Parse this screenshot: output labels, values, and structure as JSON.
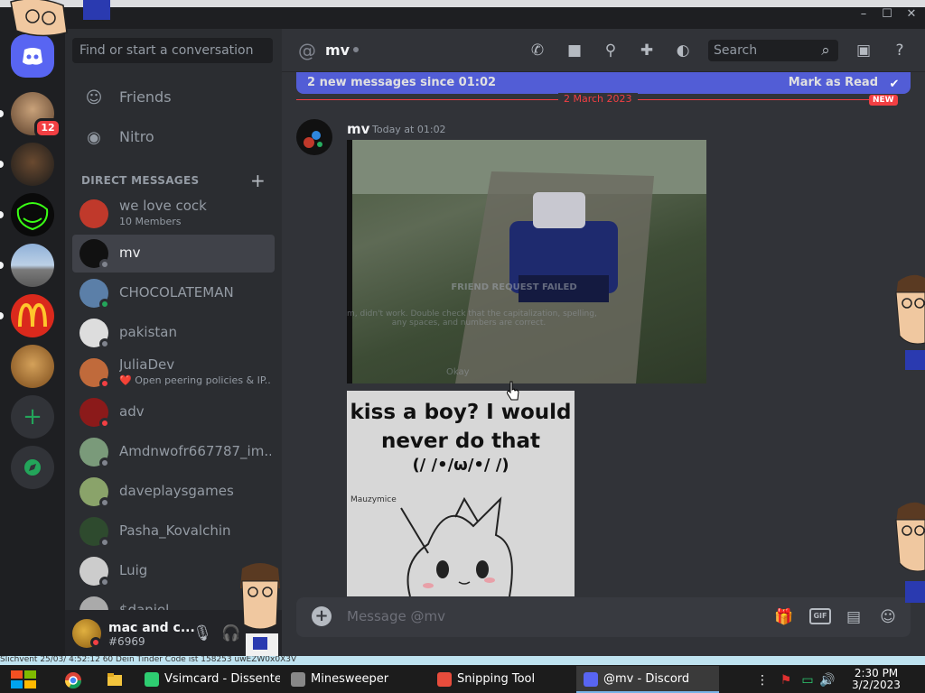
{
  "window": {
    "minimize": "–",
    "maximize": "☐",
    "close": "✕"
  },
  "search_dm": {
    "placeholder": "Find or start a conversation"
  },
  "nav": [
    {
      "label": "Friends",
      "icon": "friends-icon"
    },
    {
      "label": "Nitro",
      "icon": "nitro-icon"
    }
  ],
  "dm_header": "DIRECT MESSAGES",
  "dms": [
    {
      "name": "we love cock",
      "sub": "10 Members",
      "status": "none",
      "color": "#c0392b"
    },
    {
      "name": "mv",
      "sub": "",
      "status": "offline",
      "color": "#111111",
      "active": true
    },
    {
      "name": "CHOCOLATEMAN",
      "sub": "",
      "status": "online",
      "color": "#5b7fa8"
    },
    {
      "name": "pakistan",
      "sub": "",
      "status": "offline",
      "color": "#dddddd"
    },
    {
      "name": "JuliaDev",
      "sub": "❤️ Open peering policies & IP...",
      "status": "dnd",
      "color": "#c06a3b"
    },
    {
      "name": "adv",
      "sub": "",
      "status": "dnd",
      "color": "#8b1a1a"
    },
    {
      "name": "Amdnwofr667787_im...",
      "sub": "",
      "status": "offline",
      "color": "#7a9a7a"
    },
    {
      "name": "daveplaysgames",
      "sub": "",
      "status": "offline",
      "color": "#8aa36a"
    },
    {
      "name": "Pasha_Kovalchin",
      "sub": "",
      "status": "offline",
      "color": "#2e4a2e"
    },
    {
      "name": "Luig",
      "sub": "",
      "status": "offline",
      "color": "#cccccc"
    },
    {
      "name": "$daniel",
      "sub": "",
      "status": "offline",
      "color": "#aaaaaa"
    }
  ],
  "user": {
    "name": "mac and c...",
    "tag": "#6969"
  },
  "channel": {
    "at": "@",
    "name": "mv"
  },
  "header_search": {
    "placeholder": "Search"
  },
  "new_messages": {
    "text": "2 new messages since 01:02",
    "action": "Mark as Read"
  },
  "date_sep": "2 March 2023",
  "new_tag": "NEW",
  "message": {
    "author": "mv",
    "time": "Today at 01:02",
    "image1_overlay": {
      "title": "FRIEND REQUEST FAILED",
      "body": "Hm, didn't work. Double check that the capitalization, spelling, any spaces, and numbers are correct.",
      "button": "Okay"
    },
    "image2": {
      "caption": "kiss a boy? I would never do that",
      "kaomoji": "(/ /•/ω/•/ /)",
      "signature": "Mauzymice"
    }
  },
  "composer": {
    "placeholder": "Message @mv",
    "gif": "GIF"
  },
  "status_strip": "Slichvent    25/03/    4:52:12 60    Dein Tinder Code ist 158253 uwEZW0x0X3V",
  "taskbar": [
    {
      "label": "Vsimcard - Dissenter",
      "icon_color": "#2ecc71"
    },
    {
      "label": "Minesweeper",
      "icon_color": "#888888"
    },
    {
      "label": "Snipping Tool",
      "icon_color": "#e74c3c"
    },
    {
      "label": "@mv - Discord",
      "icon_color": "#5865f2"
    }
  ],
  "clock": {
    "time": "2:30 PM",
    "date": "3/2/2023"
  }
}
